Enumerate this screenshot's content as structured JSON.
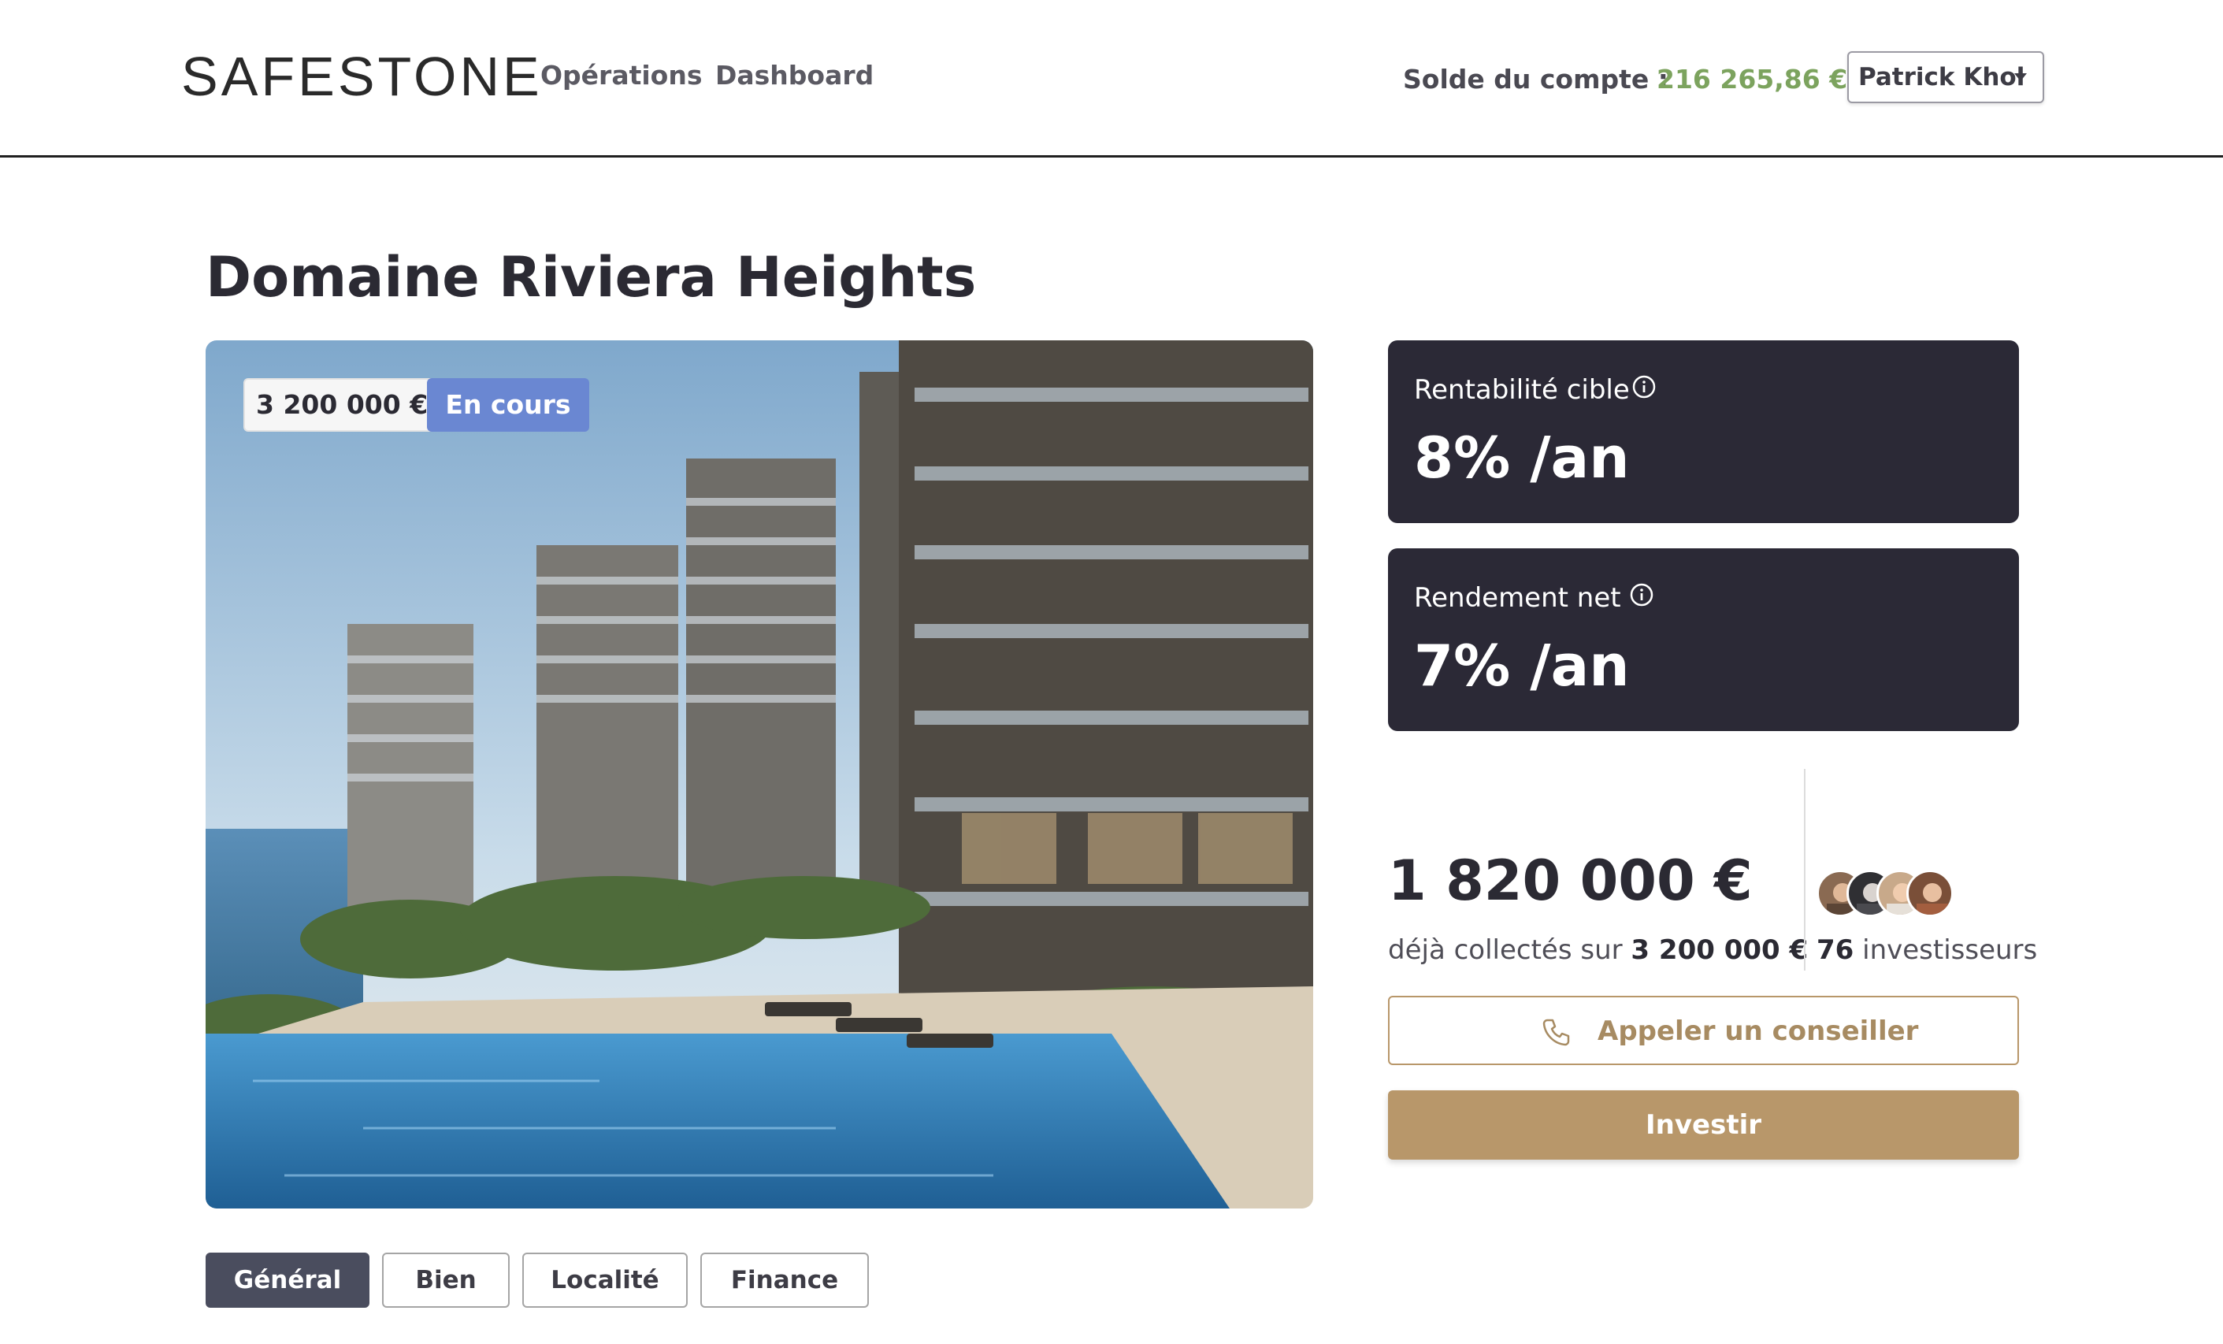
{
  "header": {
    "logo": "SAFESTONE",
    "nav": [
      {
        "label": "Opérations"
      },
      {
        "label": "Dashboard"
      }
    ],
    "balance_label": "Solde du compte :",
    "balance_value": "216 265,86 €",
    "user_name": "Patrick Khol"
  },
  "project": {
    "title": "Domaine Riviera Heights",
    "price_badge": "3 200 000 €",
    "status_badge": "En cours"
  },
  "stats": [
    {
      "label": "Rentabilité cible",
      "value": "8% /an"
    },
    {
      "label": "Rendement net",
      "value": "7% /an"
    }
  ],
  "funding": {
    "raised": "1 820 000 €",
    "raised_prefix": "déjà collectés sur",
    "raised_goal": "3 200 000 €",
    "investors_count": "76",
    "investors_suffix": "investisseurs"
  },
  "actions": {
    "call_label": "Appeler un conseiller",
    "invest_label": "Investir"
  },
  "tabs": [
    {
      "label": "Général",
      "active": true
    },
    {
      "label": "Bien"
    },
    {
      "label": "Localité"
    },
    {
      "label": "Finance"
    }
  ],
  "colors": {
    "accent_gold": "#b8976a",
    "balance_green": "#7ca35e",
    "card_dark": "#2b2936",
    "status_blue": "#6a87d2"
  },
  "icons": [
    "info-icon",
    "phone-icon",
    "chevron-down-icon"
  ]
}
